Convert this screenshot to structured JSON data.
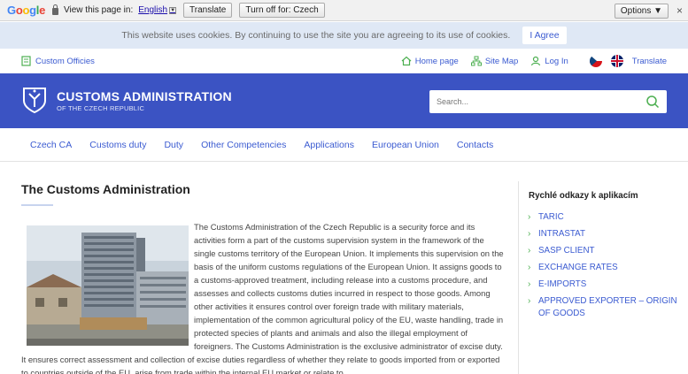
{
  "translate_bar": {
    "logo": "Google",
    "view_text": "View this page in:",
    "language": "English",
    "translate_button": "Translate",
    "turn_off_button": "Turn off for: Czech",
    "options_button": "Options ▼",
    "close": "×"
  },
  "cookie_bar": {
    "text": "This website uses cookies. By continuing to use the site you are agreeing to its use of cookies.",
    "agree_button": "I Agree"
  },
  "utility": {
    "custom_offices": "Custom Officies",
    "home_page": "Home page",
    "site_map": "Site Map",
    "log_in": "Log In",
    "translate": "Translate"
  },
  "header": {
    "title": "CUSTOMS ADMINISTRATION",
    "subtitle": "OF THE CZECH REPUBLIC",
    "search_placeholder": "Search..."
  },
  "nav": {
    "items": [
      "Czech CA",
      "Customs duty",
      "Duty",
      "Other Competencies",
      "Applications",
      "European Union",
      "Contacts"
    ]
  },
  "main": {
    "title": "The Customs Administration",
    "body": "The Customs Administration of the Czech Republic is a security force and its activities form a part of the customs supervision system in the framework of the single customs territory of the European Union. It implements this supervision on the basis of the uniform customs regulations of the European Union. It assigns goods to a customs-approved treatment, including release into a customs procedure, and assesses and collects customs duties incurred in respect to those goods. Among other activities it ensures control over foreign trade with military materials, implementation of the common agricultural policy of the EU, waste handling, trade in protected species of plants and animals and also the illegal employment of foreigners. The Customs Administration is the exclusive administrator of excise duty. It ensures correct assessment and collection of excise duties regardless of whether they relate to goods imported from or exported to countries outside of the EU, arise from trade within the internal EU market or relate to"
  },
  "sidebar": {
    "title": "Rychlé odkazy k aplikacím",
    "links": [
      "TARIC",
      "INTRASTAT",
      "SASP CLIENT",
      "EXCHANGE RATES",
      "E-IMPORTS",
      "APPROVED EXPORTER – ORIGIN OF GOODS"
    ]
  },
  "colors": {
    "header_blue": "#3b53c3",
    "link_blue": "#3b5bd1",
    "accent_green": "#4caf50",
    "cookie_bg": "#dfe8f5"
  }
}
